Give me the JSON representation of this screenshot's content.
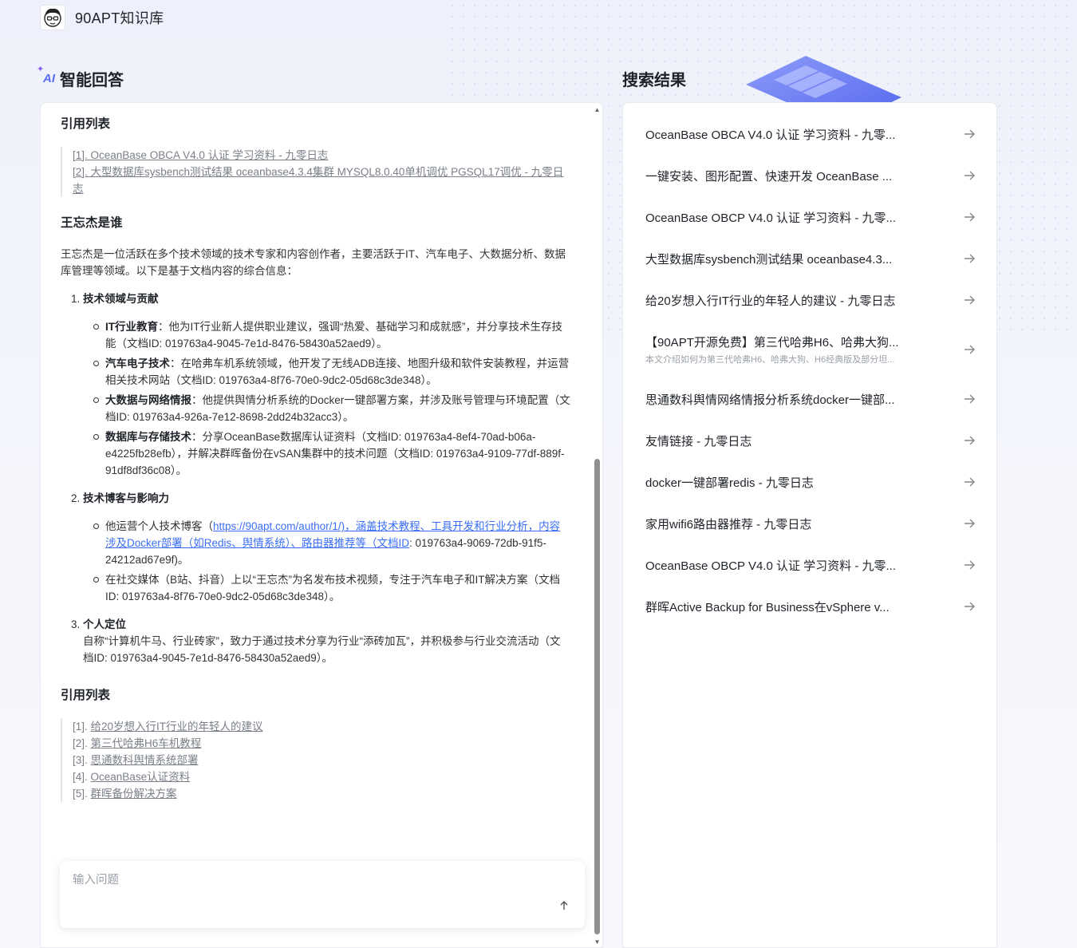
{
  "header": {
    "brand": "90APT知识库"
  },
  "left": {
    "title": "智能回答",
    "ai_badge": "AI",
    "cite_heading_1": "引用列表",
    "citations_1": [
      "[1]. OceanBase OBCA V4.0 认证 学习资料 - 九零日志",
      "[2]. 大型数据库sysbench测试结果 oceanbase4.3.4集群 MYSQL8.0.40单机调优 PGSQL17调优 - 九零日志"
    ],
    "who_heading": "王忘杰是谁",
    "intro": "王忘杰是一位活跃在多个技术领域的技术专家和内容创作者，主要活跃于IT、汽车电子、大数据分析、数据库管理等领域。以下是基于文档内容的综合信息：",
    "section1": {
      "title": "技术领域与贡献",
      "items": [
        {
          "label": "IT行业教育",
          "text": "：他为IT行业新人提供职业建议，强调“热爱、基础学习和成就感”，并分享技术生存技能（文档ID: 019763a4-9045-7e1d-8476-58430a52aed9）。"
        },
        {
          "label": "汽车电子技术",
          "text": "：在哈弗车机系统领域，他开发了无线ADB连接、地图升级和软件安装教程，并运营相关技术网站（文档ID: 019763a4-8f76-70e0-9dc2-05d68c3de348）。"
        },
        {
          "label": "大数据与网络情报",
          "text": "：他提供舆情分析系统的Docker一键部署方案，并涉及账号管理与环境配置（文档ID: 019763a4-926a-7e12-8698-2dd24b32acc3）。"
        },
        {
          "label": "数据库与存储技术",
          "text": "：分享OceanBase数据库认证资料（文档ID: 019763a4-8ef4-70ad-b06a-e4225fb28efb），并解决群晖备份在vSAN集群中的技术问题（文档ID: 019763a4-9109-77df-889f-91df8df36c08）。"
        }
      ]
    },
    "section2": {
      "title": "技术博客与影响力",
      "item1_prefix": "他运营个人技术博客（",
      "item1_link": "https://90apt.com/author/1/)，涵盖技术教程、工具开发和行业分析，内容涉及Docker部署（如Redis、舆情系统）、路由器推荐等（文档ID",
      "item1_suffix": ": 019763a4-9069-72db-91f5-24212ad67e9f)。",
      "item2": "在社交媒体（B站、抖音）上以“王忘杰”为名发布技术视频，专注于汽车电子和IT解决方案（文档ID: 019763a4-8f76-70e0-9dc2-05d68c3de348）。"
    },
    "section3": {
      "title": "个人定位",
      "text": "自称“计算机牛马、行业砖家”，致力于通过技术分享为行业“添砖加瓦”，并积极参与行业交流活动（文档ID: 019763a4-9045-7e1d-8476-58430a52aed9）。"
    },
    "cite_heading_2": "引用列表",
    "citations_2": [
      {
        "num": "[1].",
        "text": "给20岁想入行IT行业的年轻人的建议"
      },
      {
        "num": "[2].",
        "text": "第三代哈弗H6车机教程"
      },
      {
        "num": "[3].",
        "text": "思通数科舆情系统部署"
      },
      {
        "num": "[4].",
        "text": "OceanBase认证资料"
      },
      {
        "num": "[5].",
        "text": "群晖备份解决方案"
      }
    ],
    "input_placeholder": "输入问题"
  },
  "right": {
    "title": "搜索结果",
    "results": [
      {
        "title": "OceanBase OBCA V4.0 认证 学习资料 - 九零..."
      },
      {
        "title": "一键安装、图形配置、快速开发 OceanBase ..."
      },
      {
        "title": "OceanBase OBCP V4.0 认证 学习资料 - 九零..."
      },
      {
        "title": "大型数据库sysbench测试结果 oceanbase4.3..."
      },
      {
        "title": "给20岁想入行IT行业的年轻人的建议 - 九零日志"
      },
      {
        "title": "【90APT开源免费】第三代哈弗H6、哈弗大狗...",
        "subtitle": "本文介绍如何为第三代哈弗H6、哈弗大狗、H6经典版及部分坦..."
      },
      {
        "title": "思通数科舆情网络情报分析系统docker一键部..."
      },
      {
        "title": "友情链接 - 九零日志"
      },
      {
        "title": "docker一键部署redis - 九零日志"
      },
      {
        "title": "家用wifi6路由器推荐 - 九零日志"
      },
      {
        "title": "OceanBase OBCP V4.0 认证 学习资料 - 九零..."
      },
      {
        "title": "群晖Active Backup for Business在vSphere v..."
      }
    ]
  },
  "colors": {
    "accent": "#3a6ef5",
    "ai_badge": "#5a6cf3"
  }
}
